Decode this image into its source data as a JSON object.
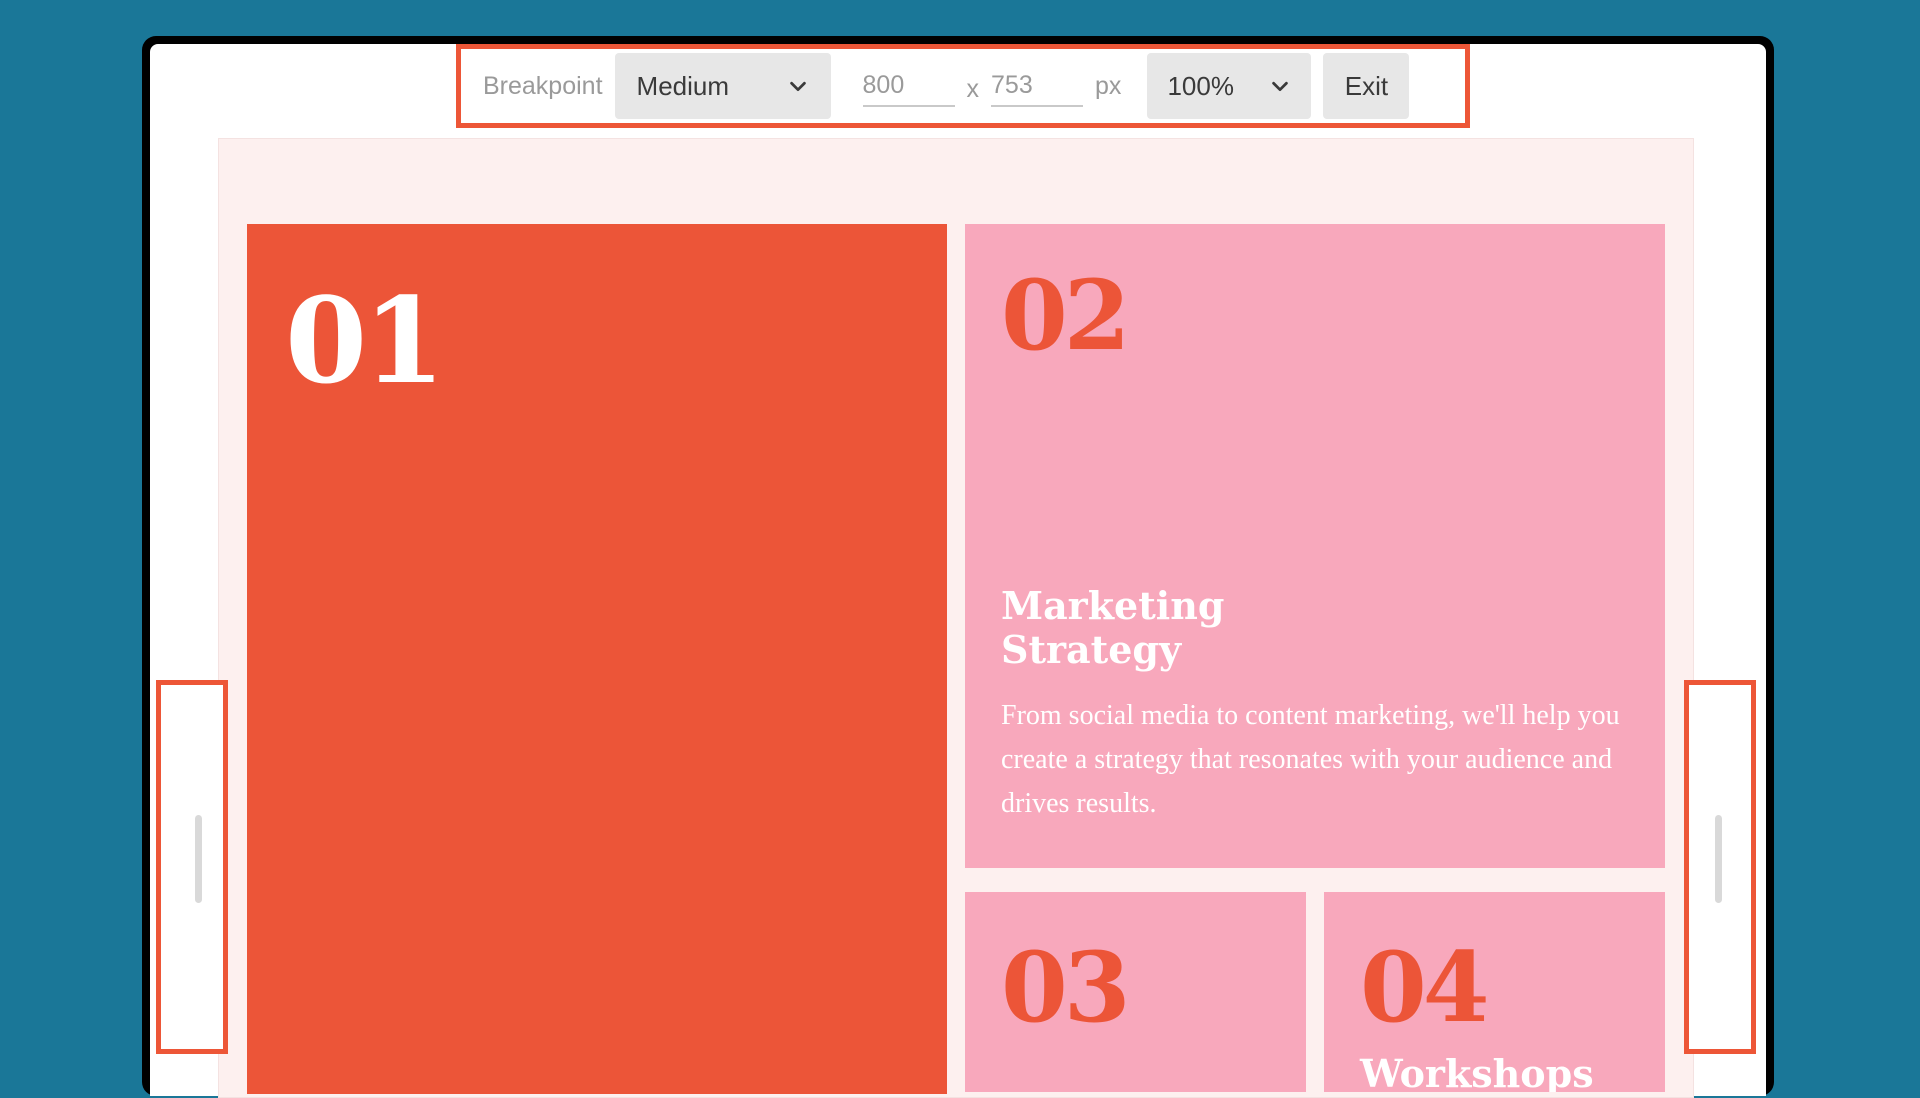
{
  "toolbar": {
    "breakpoint_label": "Breakpoint",
    "breakpoint_value": "Medium",
    "width_value": "800",
    "height_value": "753",
    "separator": "x",
    "unit": "px",
    "zoom_value": "100%",
    "exit_label": "Exit"
  },
  "cards": [
    {
      "number": "01"
    },
    {
      "number": "02",
      "title": "Marketing Strategy",
      "body": "From social media to content marketing, we'll help you create a strategy that resonates with your audience and drives results."
    },
    {
      "number": "03"
    },
    {
      "number": "04",
      "title": "Workshops"
    }
  ],
  "colors": {
    "background": "#1a7798",
    "accent": "#ed5637",
    "card_orange": "#ec5538",
    "card_pink": "#f8a8bc",
    "canvas": "#fdf0ef"
  },
  "icons": {
    "breakpoint_chevron": "chevron-down-icon",
    "zoom_chevron": "chevron-down-icon",
    "resize_grip": "drag-handle-icon"
  }
}
